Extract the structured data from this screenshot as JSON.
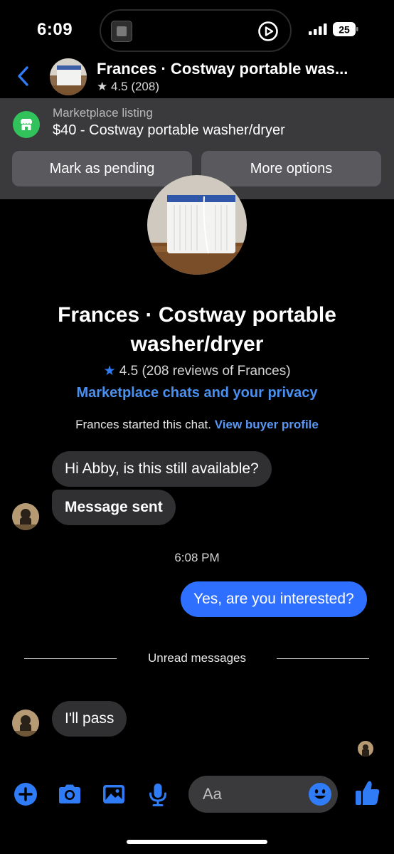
{
  "status_bar": {
    "time": "6:09",
    "battery": "25"
  },
  "header": {
    "title": "Frances · Costway portable was...",
    "rating": "★ 4.5 (208)"
  },
  "listing": {
    "kicker": "Marketplace listing",
    "title": "$40 - Costway portable washer/dryer",
    "mark_pending": "Mark as pending",
    "more_options": "More options"
  },
  "profile": {
    "name": "Frances · Costway portable washer/dryer",
    "rating_star": "★",
    "rating_text": " 4.5 (208 reviews of Frances)",
    "privacy_link": "Marketplace chats and your privacy",
    "started_text": "Frances started this chat. ",
    "view_profile": "View buyer profile"
  },
  "messages": [
    {
      "text": "Hi Abby, is this still available?"
    },
    {
      "text": "Message sent"
    },
    {
      "text": "Yes, are you interested?"
    },
    {
      "text": "I'll pass"
    }
  ],
  "timestamp": "6:08 PM",
  "unread_divider": "Unread messages",
  "composer": {
    "placeholder": "Aa"
  },
  "colors": {
    "accent": "#2f6fff",
    "link": "#4a90f0",
    "marketplace_green": "#31c25c",
    "bubble_incoming": "#303033",
    "banner_bg": "#3a3a3c"
  },
  "icons": [
    "back-icon",
    "star-icon",
    "marketplace-shop-icon",
    "plus-icon",
    "camera-icon",
    "photo-icon",
    "microphone-icon",
    "emoji-icon",
    "thumbs-up-icon",
    "play-circle-icon",
    "cellular-signal-icon",
    "battery-icon"
  ]
}
